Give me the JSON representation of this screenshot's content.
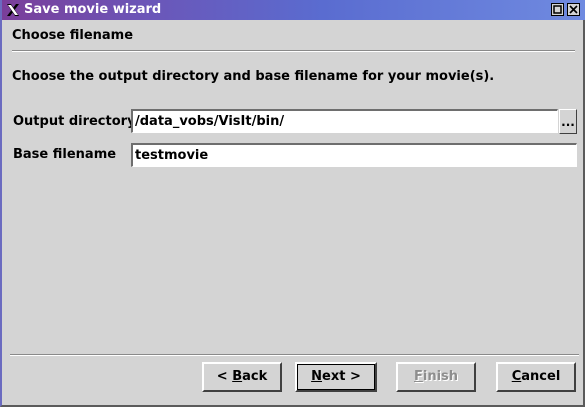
{
  "window": {
    "title": "Save movie wizard",
    "icon": "x-logo-icon",
    "controls": [
      "maximize-icon",
      "close-icon"
    ]
  },
  "page": {
    "header": "Choose filename",
    "instructions": "Choose the output directory and base filename for your movie(s)."
  },
  "form": {
    "output_directory_label": "Output directory",
    "output_directory_value": "/data_vobs/VisIt/bin/",
    "browse_label": "...",
    "base_filename_label": "Base filename",
    "base_filename_value": "testmovie"
  },
  "buttons": {
    "back": {
      "prefix": "< ",
      "mnemonic": "B",
      "rest": "ack"
    },
    "next": {
      "mnemonic": "N",
      "rest": "ext >"
    },
    "finish": {
      "mnemonic": "F",
      "rest": "inish",
      "enabled": false
    },
    "cancel": {
      "mnemonic": "C",
      "rest": "ancel"
    }
  },
  "colors": {
    "background": "#d4d4d4",
    "titlebar_start": "#7a3e9a",
    "titlebar_end": "#6f8ae0",
    "disabled_text": "#8e8e8e"
  }
}
